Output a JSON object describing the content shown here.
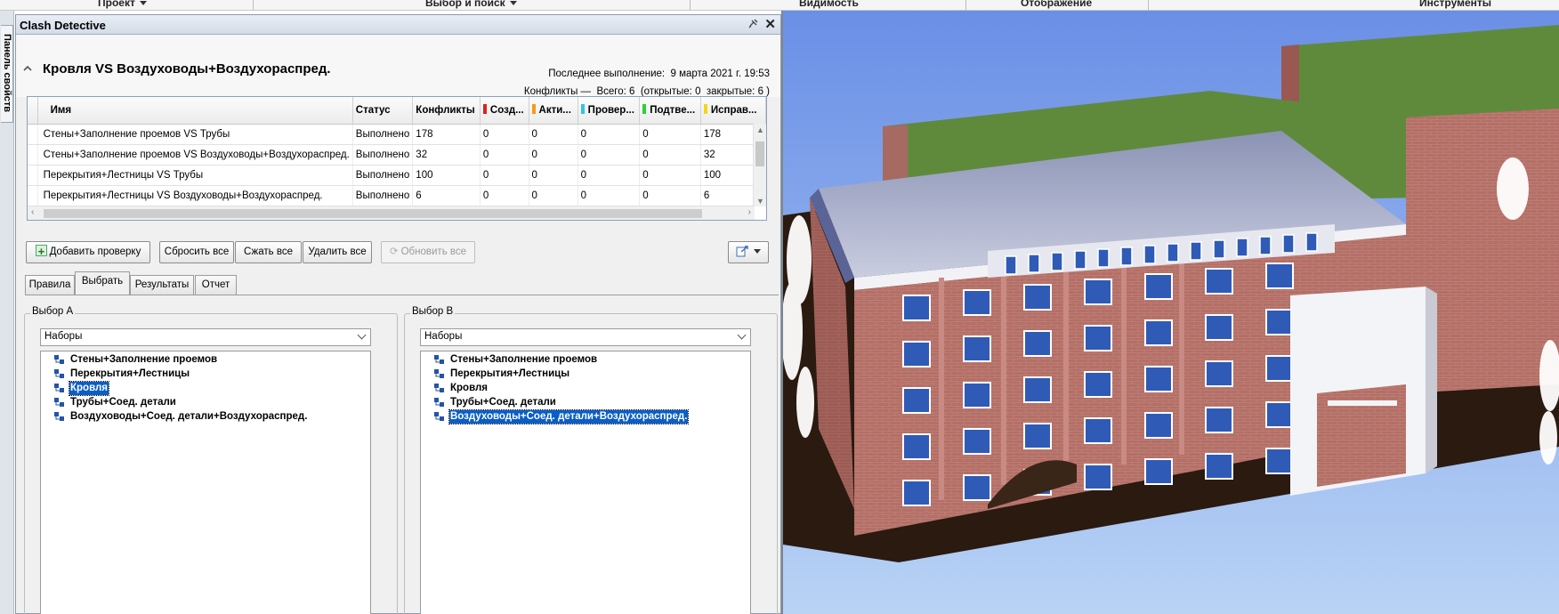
{
  "ribbon": {
    "tabs": [
      {
        "label": "Проект",
        "dropdown": true
      },
      {
        "label": "Выбор и поиск",
        "dropdown": true
      },
      {
        "label": "Видимость",
        "dropdown": false
      },
      {
        "label": "Отображение",
        "dropdown": false
      },
      {
        "label": "Инструменты",
        "dropdown": false
      }
    ]
  },
  "side_strip": {
    "tab_label": "Панель свойств"
  },
  "panel": {
    "title": "Clash Detective",
    "pin_icon": "pin-icon",
    "close_icon": "close-icon",
    "test_name": "Кровля VS Воздуховоды+Воздухораспред.",
    "last_run_label": "Последнее выполнение:",
    "last_run_value": "9 марта 2021 г. 19:53",
    "summary": {
      "conflicts_label": "Конфликты —",
      "total_label": "Всего:",
      "total": "6",
      "open_label": "(открытые:",
      "open": "0",
      "closed_label": "закрытые:",
      "closed": "6 )"
    }
  },
  "grid": {
    "columns": [
      {
        "label": "Имя",
        "swatch": null
      },
      {
        "label": "Статус",
        "swatch": null
      },
      {
        "label": "Конфликты",
        "swatch": null
      },
      {
        "label": "Созд...",
        "swatch": "#e0201b"
      },
      {
        "label": "Акти...",
        "swatch": "#f59a1a"
      },
      {
        "label": "Провер...",
        "swatch": "#2ec4e8"
      },
      {
        "label": "Подтве...",
        "swatch": "#2ccf3a"
      },
      {
        "label": "Исправ...",
        "swatch": "#f3d618"
      }
    ],
    "rows": [
      [
        "Стены+Заполнение проемов VS Трубы",
        "Выполнено",
        "178",
        "0",
        "0",
        "0",
        "0",
        "178"
      ],
      [
        "Стены+Заполнение проемов VS Воздуховоды+Воздухораспред.",
        "Выполнено",
        "32",
        "0",
        "0",
        "0",
        "0",
        "32"
      ],
      [
        "Перекрытия+Лестницы VS Трубы",
        "Выполнено",
        "100",
        "0",
        "0",
        "0",
        "0",
        "100"
      ],
      [
        "Перекрытия+Лестницы VS Воздуховоды+Воздухораспред.",
        "Выполнено",
        "6",
        "0",
        "0",
        "0",
        "0",
        "6"
      ]
    ]
  },
  "buttons": {
    "add_test": "Добавить проверку",
    "reset_all": "Сбросить все",
    "compact_all": "Сжать все",
    "delete_all": "Удалить все",
    "update_all": "Обновить все",
    "export_icon": "export-icon"
  },
  "tabs": [
    "Правила",
    "Выбрать",
    "Результаты",
    "Отчет"
  ],
  "active_tab": "Выбрать",
  "selection_a": {
    "legend": "Выбор A",
    "combo": "Наборы",
    "items": [
      "Стены+Заполнение проемов",
      "Перекрытия+Лестницы",
      "Кровля",
      "Трубы+Соед. детали",
      "Воздуховоды+Соед. детали+Воздухораспред."
    ],
    "selected": "Кровля"
  },
  "selection_b": {
    "legend": "Выбор B",
    "combo": "Наборы",
    "items": [
      "Стены+Заполнение проемов",
      "Перекрытия+Лестницы",
      "Кровля",
      "Трубы+Соед. детали",
      "Воздуховоды+Соед. детали+Воздухораспред."
    ],
    "selected": "Воздуховоды+Соед. детали+Воздухораспред."
  },
  "colors": {
    "sky_top": "#6a8fe6",
    "sky_bottom": "#b9d3f5",
    "roof_green": "#5f8a3c",
    "roof_grey": "#b9bfd4",
    "brick": "#b46f66",
    "selection": "#0a5ec7"
  }
}
